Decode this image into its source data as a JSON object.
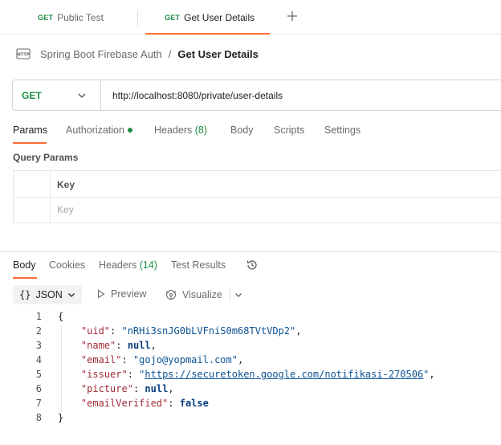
{
  "tabs": [
    {
      "method": "GET",
      "label": "Public Test",
      "active": false
    },
    {
      "method": "GET",
      "label": "Get User Details",
      "active": true
    }
  ],
  "breadcrumb": {
    "collection": "Spring Boot Firebase Auth",
    "separator": "/",
    "current": "Get User Details"
  },
  "request": {
    "method": "GET",
    "url": "http://localhost:8080/private/user-details"
  },
  "request_tabs": {
    "params": "Params",
    "authorization": "Authorization",
    "headers": "Headers",
    "headers_count": "(8)",
    "body": "Body",
    "scripts": "Scripts",
    "settings": "Settings"
  },
  "query_params": {
    "title": "Query Params",
    "header_key": "Key",
    "placeholder_key": "Key"
  },
  "response_tabs": {
    "body": "Body",
    "cookies": "Cookies",
    "headers": "Headers",
    "headers_count": "(14)",
    "test_results": "Test Results"
  },
  "response_toolbar": {
    "format": "JSON",
    "braces": "{}",
    "preview": "Preview",
    "visualize": "Visualize"
  },
  "response_body": {
    "line_numbers": [
      "1",
      "2",
      "3",
      "4",
      "5",
      "6",
      "7",
      "8"
    ],
    "open": "{",
    "close": "}",
    "uid_key": "\"uid\"",
    "uid_val": "\"nRHi3snJG0bLVFniS0m68TVtVDp2\"",
    "name_key": "\"name\"",
    "name_val": "null",
    "email_key": "\"email\"",
    "email_val": "\"gojo@yopmail.com\"",
    "issuer_key": "\"issuer\"",
    "issuer_q": "\"",
    "issuer_url": "https://securetoken.google.com/notifikasi-270506",
    "picture_key": "\"picture\"",
    "picture_val": "null",
    "emailVerified_key": "\"emailVerified\"",
    "emailVerified_val": "false"
  },
  "colors": {
    "accent": "#ff6c37",
    "get_method": "#1c8c42",
    "json_key": "#a22b36",
    "json_string": "#0c5293"
  }
}
